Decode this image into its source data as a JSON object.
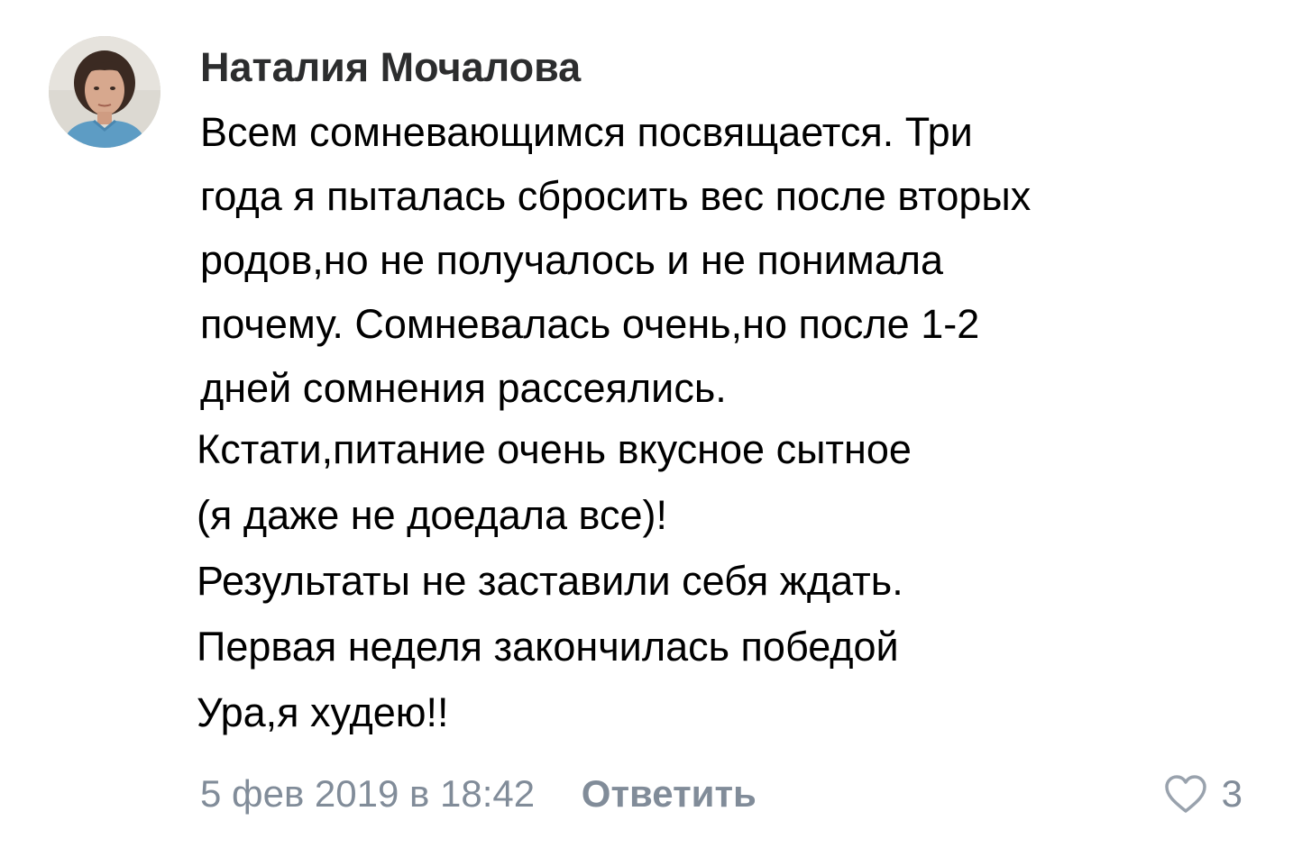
{
  "comment": {
    "author": "Наталия Мочалова",
    "paragraphs": [
      [
        "Всем сомневающимся посвящается. Три",
        "года я пыталась сбросить вес после вторых",
        "родов,но не получалось и не понимала",
        "почему. Сомневалась очень,но после 1-2",
        "дней сомнения рассеялись."
      ],
      [
        "Кстати,питание очень вкусное сытное",
        "(я даже не доедала все)!",
        "Результаты не заставили себя ждать.",
        "Первая неделя закончилась победой",
        "Ура,я худею!!"
      ]
    ],
    "date": "5 фев 2019 в 18:42",
    "reply_label": "Ответить",
    "likes_count": "3",
    "icons": {
      "avatar": "user-photo",
      "like": "heart-outline-icon"
    },
    "colors": {
      "author": "#2c2d2e",
      "secondary": "#818c99"
    }
  }
}
